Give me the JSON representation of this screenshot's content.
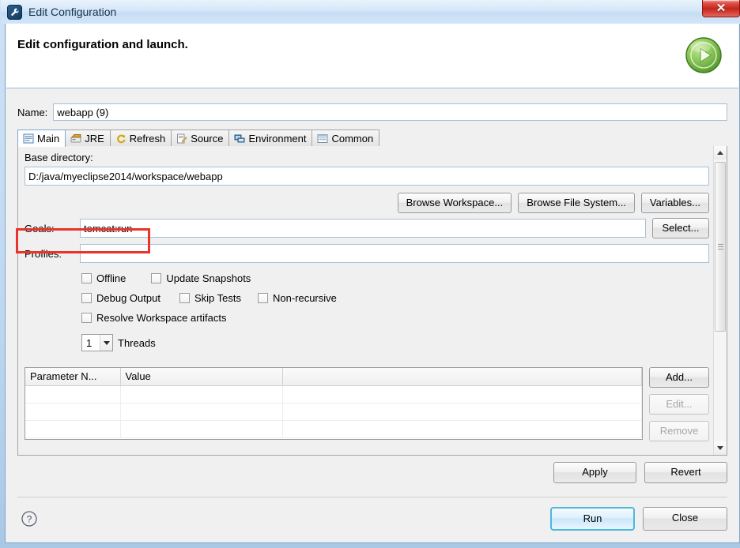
{
  "window": {
    "title": "Edit Configuration",
    "app_icon": "wrench-icon",
    "close_label": "✕"
  },
  "header": {
    "title": "Edit configuration and launch.",
    "icon": "green-run-play-icon"
  },
  "name_row": {
    "label": "Name:",
    "value": "webapp (9)"
  },
  "tabs": [
    {
      "label": "Main",
      "icon": "main-tab-icon",
      "active": true
    },
    {
      "label": "JRE",
      "icon": "jre-tab-icon",
      "active": false
    },
    {
      "label": "Refresh",
      "icon": "refresh-tab-icon",
      "active": false
    },
    {
      "label": "Source",
      "icon": "source-tab-icon",
      "active": false
    },
    {
      "label": "Environment",
      "icon": "environment-tab-icon",
      "active": false
    },
    {
      "label": "Common",
      "icon": "common-tab-icon",
      "active": false
    }
  ],
  "main_tab": {
    "base_directory": {
      "label": "Base directory:",
      "value": "D:/java/myeclipse2014/workspace/webapp"
    },
    "dir_buttons": [
      {
        "label": "Browse Workspace...",
        "enabled": true
      },
      {
        "label": "Browse File System...",
        "enabled": true
      },
      {
        "label": "Variables...",
        "enabled": true
      }
    ],
    "goals": {
      "label": "Goals:",
      "value": "tomcat:run",
      "select_button": "Select...",
      "focused": true
    },
    "profiles": {
      "label": "Profiles:",
      "value": ""
    },
    "checkboxes": [
      {
        "label": "Offline",
        "checked": false
      },
      {
        "label": "Update Snapshots",
        "checked": false
      },
      {
        "label": "Debug Output",
        "checked": false
      },
      {
        "label": "Skip Tests",
        "checked": false
      },
      {
        "label": "Non-recursive",
        "checked": false
      },
      {
        "label": "Resolve Workspace artifacts",
        "checked": false
      }
    ],
    "threads": {
      "value": "1",
      "label": "Threads"
    },
    "parameters_table": {
      "columns": [
        "Parameter N...",
        "Value",
        ""
      ],
      "rows": [
        [
          "",
          "",
          ""
        ],
        [
          "",
          "",
          ""
        ],
        [
          "",
          "",
          ""
        ]
      ]
    },
    "table_buttons": [
      {
        "label": "Add...",
        "enabled": true
      },
      {
        "label": "Edit...",
        "enabled": false
      },
      {
        "label": "Remove",
        "enabled": false
      }
    ]
  },
  "apply_row": [
    {
      "label": "Apply",
      "enabled": true
    },
    {
      "label": "Revert",
      "enabled": true
    }
  ],
  "footer": {
    "help_icon": "help-question-icon",
    "run_button": "Run",
    "close_button": "Close"
  },
  "colors": {
    "annotation": "#e8342a",
    "default_button_border": "#4fb6e0",
    "titlebar": "#d3e6f8",
    "close_button": "#c4241b"
  }
}
